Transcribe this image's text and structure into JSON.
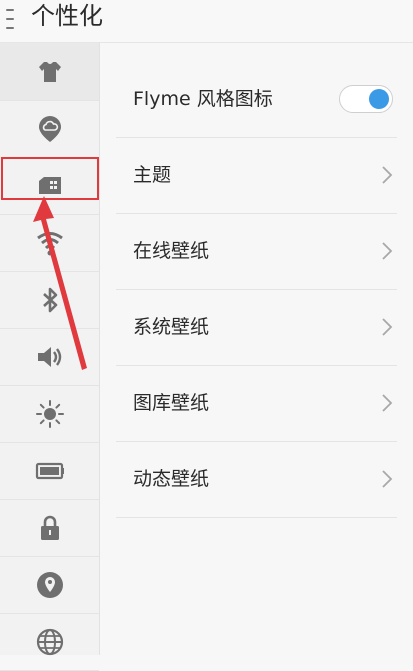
{
  "header": {
    "title": "个性化"
  },
  "sidebar": {
    "items": [
      {
        "icon": "shirt-icon",
        "active": true
      },
      {
        "icon": "cloud-pin-icon"
      },
      {
        "icon": "wallpaper-card-icon"
      },
      {
        "icon": "wifi-icon"
      },
      {
        "icon": "bluetooth-icon"
      },
      {
        "icon": "speaker-icon"
      },
      {
        "icon": "brightness-icon"
      },
      {
        "icon": "battery-icon"
      },
      {
        "icon": "lock-icon"
      },
      {
        "icon": "location-icon"
      },
      {
        "icon": "globe-icon"
      }
    ]
  },
  "settings": {
    "rows": [
      {
        "label": "Flyme 风格图标",
        "control": "toggle",
        "toggle_on": true
      },
      {
        "label": "主题",
        "control": "chevron"
      },
      {
        "label": "在线壁纸",
        "control": "chevron"
      },
      {
        "label": "系统壁纸",
        "control": "chevron"
      },
      {
        "label": "图库壁纸",
        "control": "chevron"
      },
      {
        "label": "动态壁纸",
        "control": "chevron"
      }
    ]
  },
  "annotation": {
    "highlight_color": "#e0393e"
  },
  "colors": {
    "accent": "#3a9ae6",
    "icon": "#6f6f6f"
  }
}
